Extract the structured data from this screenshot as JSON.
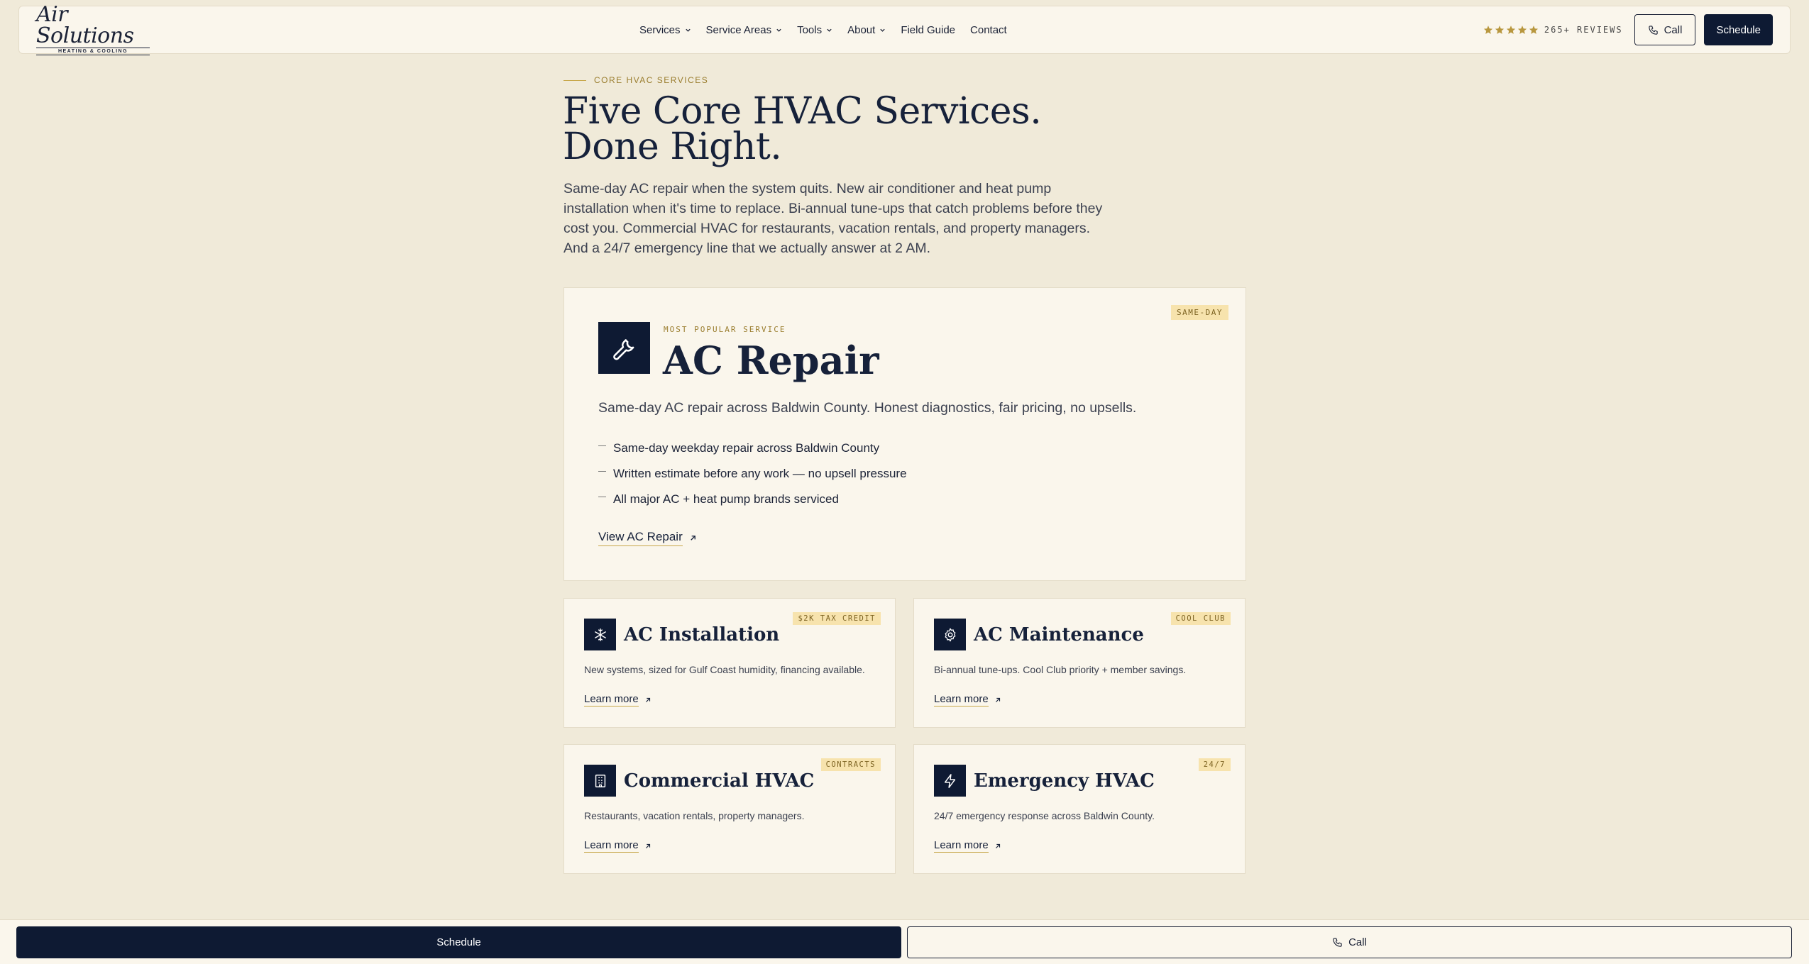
{
  "header": {
    "logo": {
      "main": "Air Solutions",
      "sub": "HEATING & COOLING"
    },
    "nav": [
      {
        "label": "Services",
        "dropdown": true
      },
      {
        "label": "Service Areas",
        "dropdown": true
      },
      {
        "label": "Tools",
        "dropdown": true
      },
      {
        "label": "About",
        "dropdown": true
      },
      {
        "label": "Field Guide",
        "dropdown": false
      },
      {
        "label": "Contact",
        "dropdown": false
      }
    ],
    "rating": {
      "stars": 5,
      "reviews_label": "265+ REVIEWS"
    },
    "call_label": "Call",
    "schedule_label": "Schedule"
  },
  "hero": {
    "eyebrow": "CORE HVAC SERVICES",
    "title": "Five Core HVAC Services. Done Right.",
    "body": "Same-day AC repair when the system quits. New air conditioner and heat pump installation when it's time to replace. Bi-annual tune-ups that catch problems before they cost you. Commercial HVAC for restaurants, vacation rentals, and property managers. And a 24/7 emergency line that we actually answer at 2 AM."
  },
  "featured": {
    "badge": "SAME-DAY",
    "icon": "wrench-icon",
    "eyebrow": "MOST POPULAR SERVICE",
    "title": "AC Repair",
    "desc": "Same-day AC repair across Baldwin County. Honest diagnostics, fair pricing, no upsells.",
    "bullets": [
      "Same-day weekday repair across Baldwin County",
      "Written estimate before any work — no upsell pressure",
      "All major AC + heat pump brands serviced"
    ],
    "link": "View AC Repair"
  },
  "services": [
    {
      "title": "AC Installation",
      "badge": "$2K TAX CREDIT",
      "icon": "snowflake-icon",
      "desc": "New systems, sized for Gulf Coast humidity, financing available.",
      "link": "Learn more"
    },
    {
      "title": "AC Maintenance",
      "badge": "COOL CLUB",
      "icon": "gear-icon",
      "desc": "Bi-annual tune-ups. Cool Club priority + member savings.",
      "link": "Learn more"
    },
    {
      "title": "Commercial HVAC",
      "badge": "CONTRACTS",
      "icon": "building-icon",
      "desc": "Restaurants, vacation rentals, property managers.",
      "link": "Learn more"
    },
    {
      "title": "Emergency HVAC",
      "badge": "24/7",
      "icon": "lightning-icon",
      "desc": "24/7 emergency response across Baldwin County.",
      "link": "Learn more"
    }
  ],
  "bottom_bar": {
    "schedule_label": "Schedule",
    "call_label": "Call"
  },
  "colors": {
    "navy": "#0e1a33",
    "gold": "#c7a74a",
    "badge_bg": "#f7e3ad",
    "page_bg": "#f0ead9",
    "card_bg": "#faf6ec"
  }
}
